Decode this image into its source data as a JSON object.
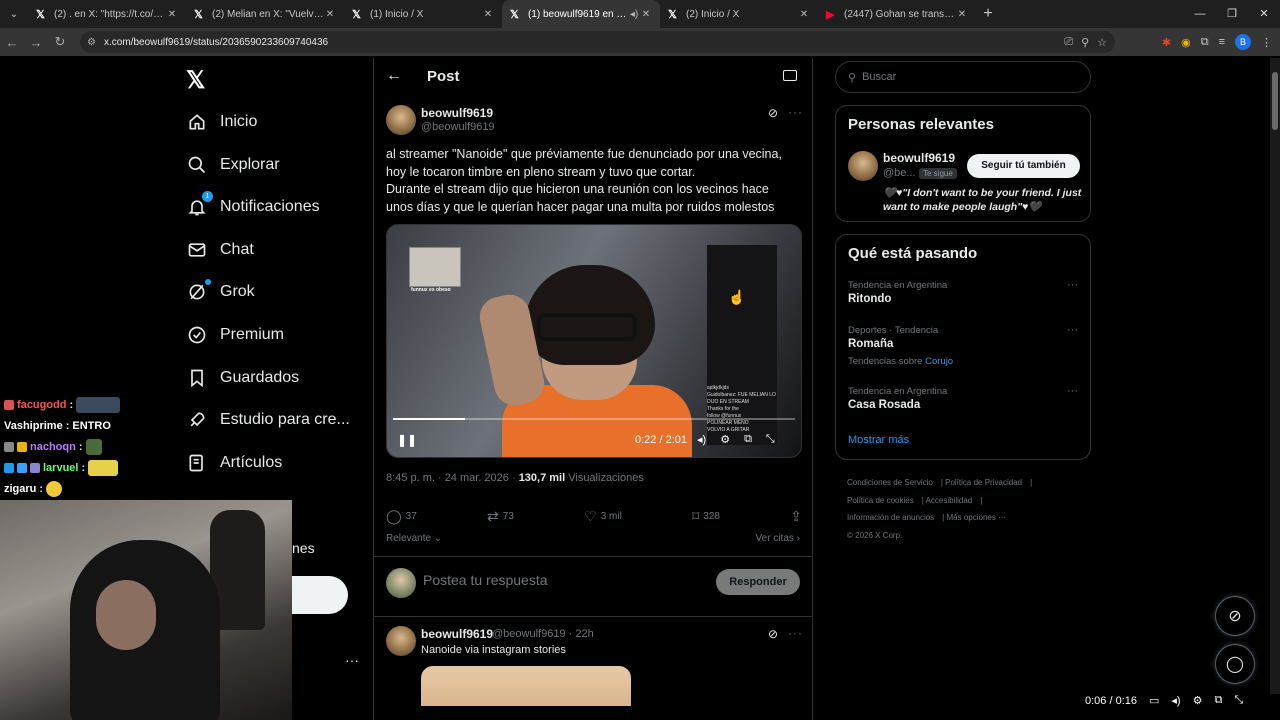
{
  "browser": {
    "tabs": [
      {
        "icon": "x-logo-icon",
        "title": "(2) . en X: \"https://t.co/NjowkVj\""
      },
      {
        "icon": "x-logo-icon",
        "title": "(2) Melian en X: \"Vuelve la mejor\""
      },
      {
        "icon": "x-logo-icon",
        "title": "(1) Inicio / X"
      },
      {
        "icon": "x-logo-icon",
        "title": "(1) beowulf9619 en X: \"al st",
        "active": true
      },
      {
        "icon": "x-logo-icon",
        "title": "(2) Inicio / X"
      },
      {
        "icon": "youtube-icon",
        "title": "(2447) Gohan se transforma en"
      }
    ],
    "url": "x.com/beowulf9619/status/2036590233609740436",
    "profile_initial": "B"
  },
  "left_nav": {
    "items": [
      {
        "label": "Inicio",
        "icon": "home-icon"
      },
      {
        "label": "Explorar",
        "icon": "search-icon"
      },
      {
        "label": "Notificaciones",
        "icon": "bell-icon",
        "badge": "1"
      },
      {
        "label": "Chat",
        "icon": "mail-icon"
      },
      {
        "label": "Grok",
        "icon": "grok-icon"
      },
      {
        "label": "Premium",
        "icon": "verified-icon"
      },
      {
        "label": "Guardados",
        "icon": "bookmark-icon"
      },
      {
        "label": "Estudio para cre...",
        "icon": "rocket-icon"
      },
      {
        "label": "Artículos",
        "icon": "article-icon"
      }
    ],
    "partial_label": "nes"
  },
  "stream_chat": [
    {
      "user": "facugodd",
      "color": "#ff4f4f",
      "msg": ""
    },
    {
      "user": "Vashiprime",
      "color": "#ffffff",
      "msg": "ENTRO"
    },
    {
      "user": "nachoqn",
      "color": "#b77cff",
      "msg": ""
    },
    {
      "user": "larvuel",
      "color": "#66ff66",
      "msg": ""
    },
    {
      "user": "zigaru",
      "color": "#ffffff",
      "msg": ""
    }
  ],
  "post": {
    "header": "Post",
    "author_name": "beowulf9619",
    "author_handle": "@beowulf9619",
    "text_lines": [
      "al streamer \"Nanoide\" que préviamente fue denunciado por una vecina,",
      "hoy le tocaron timbre en pleno stream y tuvo que cortar.",
      "Durante el stream dijo que hicieron una reunión con los vecinos hace",
      "unos días y que le querían hacer pagar una multa por ruidos molestos"
    ],
    "video": {
      "time": "0:22 / 2:01",
      "progress": 0.18,
      "pip_label": "funnux es obeso",
      "chat_overlay": [
        "ajdkjdkjds",
        "Guidolbanez: FUE MELIAN LO",
        "DIJO EN STREAM",
        "Thanks for the",
        "follow @funnux",
        "POLINEAR MENO",
        "VOLVIO A GRITAR"
      ]
    },
    "timestamp": "8:45 p. m. · 24 mar. 2026 ·",
    "views_count": "130,7 mil",
    "views_label": "Visualizaciones",
    "replies": "37",
    "reposts": "73",
    "likes": "3 mil",
    "bookmarks": "328",
    "sort_label": "Relevante",
    "quotes_label": "Ver citas",
    "reply_placeholder": "Postea tu respuesta",
    "reply_button": "Responder"
  },
  "reply_tweet": {
    "author_name": "beowulf9619",
    "author_meta": "@beowulf9619 · 22h",
    "text": "Nanoide via instagram stories"
  },
  "sidebar": {
    "search_placeholder": "Buscar",
    "relevant": {
      "title": "Personas relevantes",
      "name": "beowulf9619",
      "handle": "@be...",
      "follows_you": "Te sigue",
      "follow_button": "Seguir tú también",
      "bio": "🖤♥\"I don't want to be your friend. I just want to make people laugh\"♥🖤"
    },
    "trending": {
      "title": "Qué está pasando",
      "items": [
        {
          "context": "Tendencia en Argentina",
          "name": "Ritondo",
          "sub": null
        },
        {
          "context": "Deportes · Tendencia",
          "name": "Romaña",
          "sub": "Tendencias sobre",
          "sub_link": "Corujo"
        },
        {
          "context": "Tendencia en Argentina",
          "name": "Casa Rosada",
          "sub": null
        }
      ],
      "show_more": "Mostrar más"
    },
    "footer": [
      "Condiciones de Servicio",
      "Política de Privacidad",
      "Política de cookies",
      "Accesibilidad",
      "Información de anuncios",
      "Más opciones ···",
      "© 2026 X Corp."
    ]
  },
  "media_player": {
    "time": "0:06 / 0:16"
  }
}
